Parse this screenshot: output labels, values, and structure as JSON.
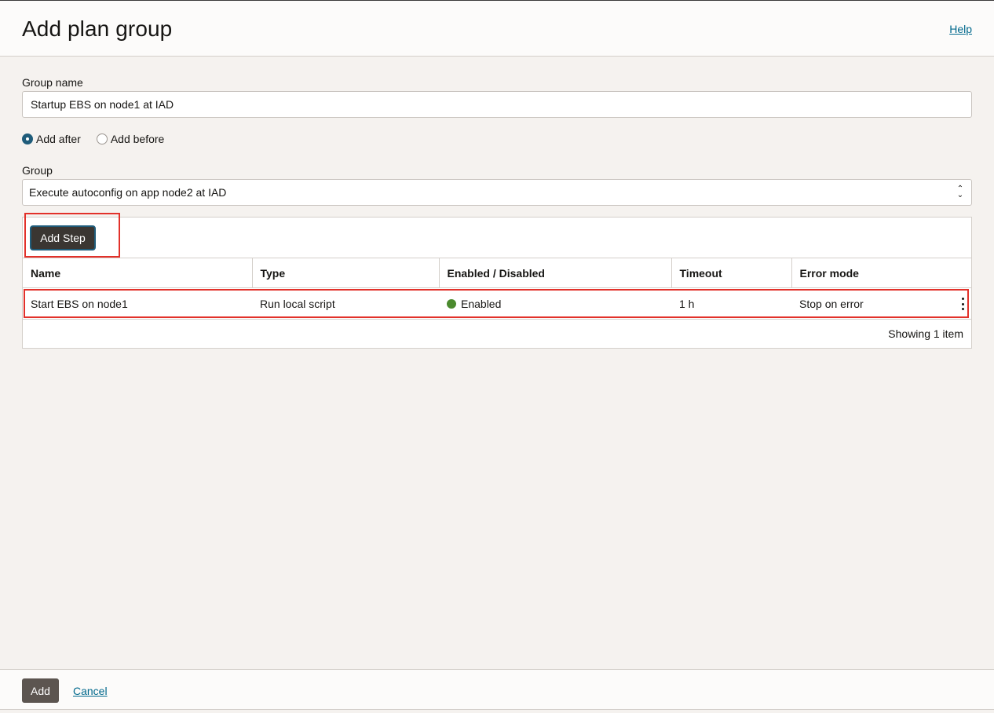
{
  "header": {
    "title": "Add plan group",
    "help_label": "Help"
  },
  "form": {
    "group_name_label": "Group name",
    "group_name_value": "Startup EBS on node1 at IAD",
    "radio_options": [
      {
        "label": "Add after",
        "checked": true
      },
      {
        "label": "Add before",
        "checked": false
      }
    ],
    "group_label": "Group",
    "group_selected": "Execute autoconfig on app node2 at IAD"
  },
  "steps_table": {
    "add_step_label": "Add Step",
    "columns": [
      "Name",
      "Type",
      "Enabled / Disabled",
      "Timeout",
      "Error mode"
    ],
    "rows": [
      {
        "name": "Start EBS on node1",
        "type": "Run local script",
        "status": "Enabled",
        "timeout": "1 h",
        "error_mode": "Stop on error"
      }
    ],
    "footer_count": "Showing 1 item"
  },
  "footer": {
    "add_label": "Add",
    "cancel_label": "Cancel"
  },
  "colors": {
    "accent": "#1f5c7a",
    "link": "#00688c",
    "status_enabled": "#4b8a2e",
    "highlight": "#e2312a"
  }
}
